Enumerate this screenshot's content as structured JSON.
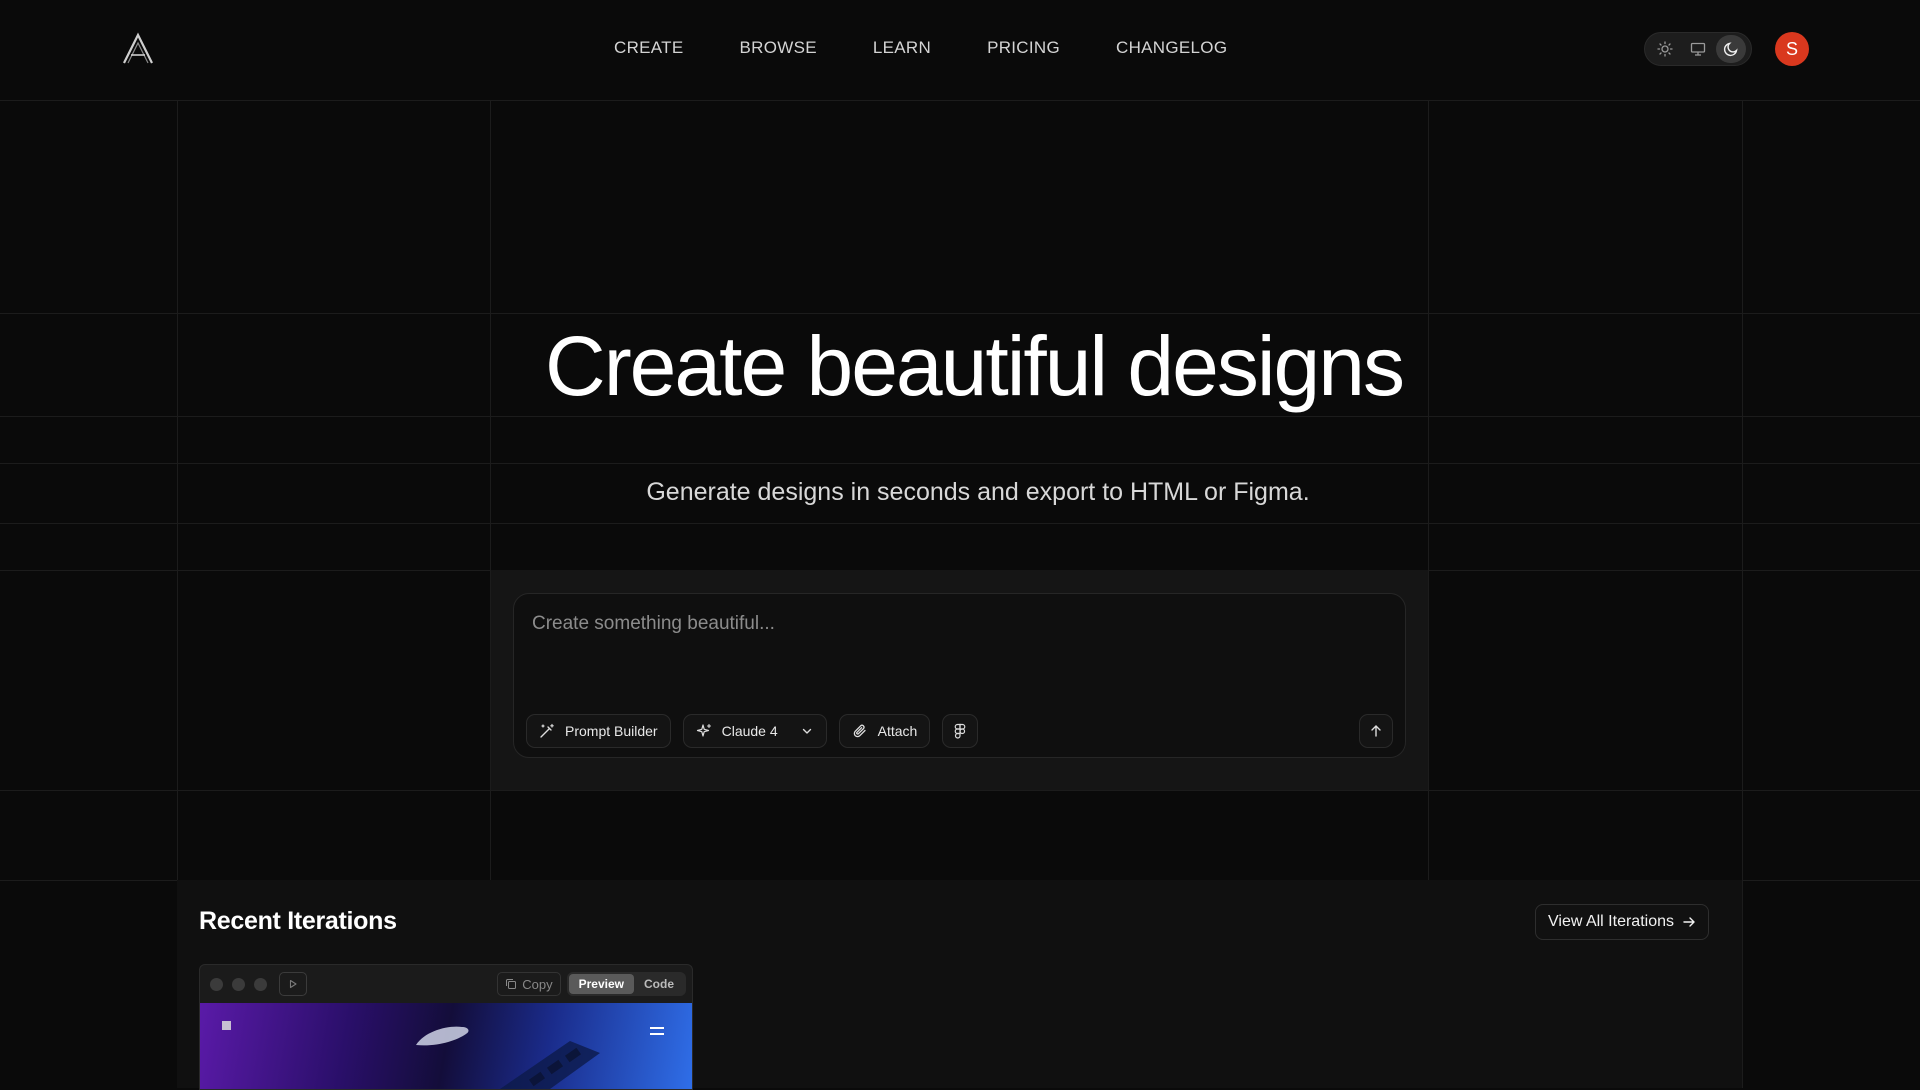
{
  "app": {
    "logo_letter": "A"
  },
  "nav": {
    "items": [
      "CREATE",
      "BROWSE",
      "LEARN",
      "PRICING",
      "CHANGELOG"
    ]
  },
  "theme_toggle": {
    "options": [
      "sun-icon",
      "monitor-icon",
      "moon-icon"
    ],
    "selected": "moon-icon"
  },
  "user": {
    "avatar_initial": "S",
    "avatar_color": "#d9381e"
  },
  "hero": {
    "title": "Create beautiful designs",
    "subtitle": "Generate designs in seconds and export to HTML or Figma."
  },
  "prompt": {
    "placeholder": "Create something beautiful...",
    "prompt_builder_label": "Prompt Builder",
    "model_label": "Claude 4",
    "attach_label": "Attach"
  },
  "recent": {
    "title": "Recent Iterations",
    "view_all_label": "View All Iterations",
    "card": {
      "copy_label": "Copy",
      "preview_label": "Preview",
      "code_label": "Code",
      "active_tab": "Preview"
    }
  }
}
